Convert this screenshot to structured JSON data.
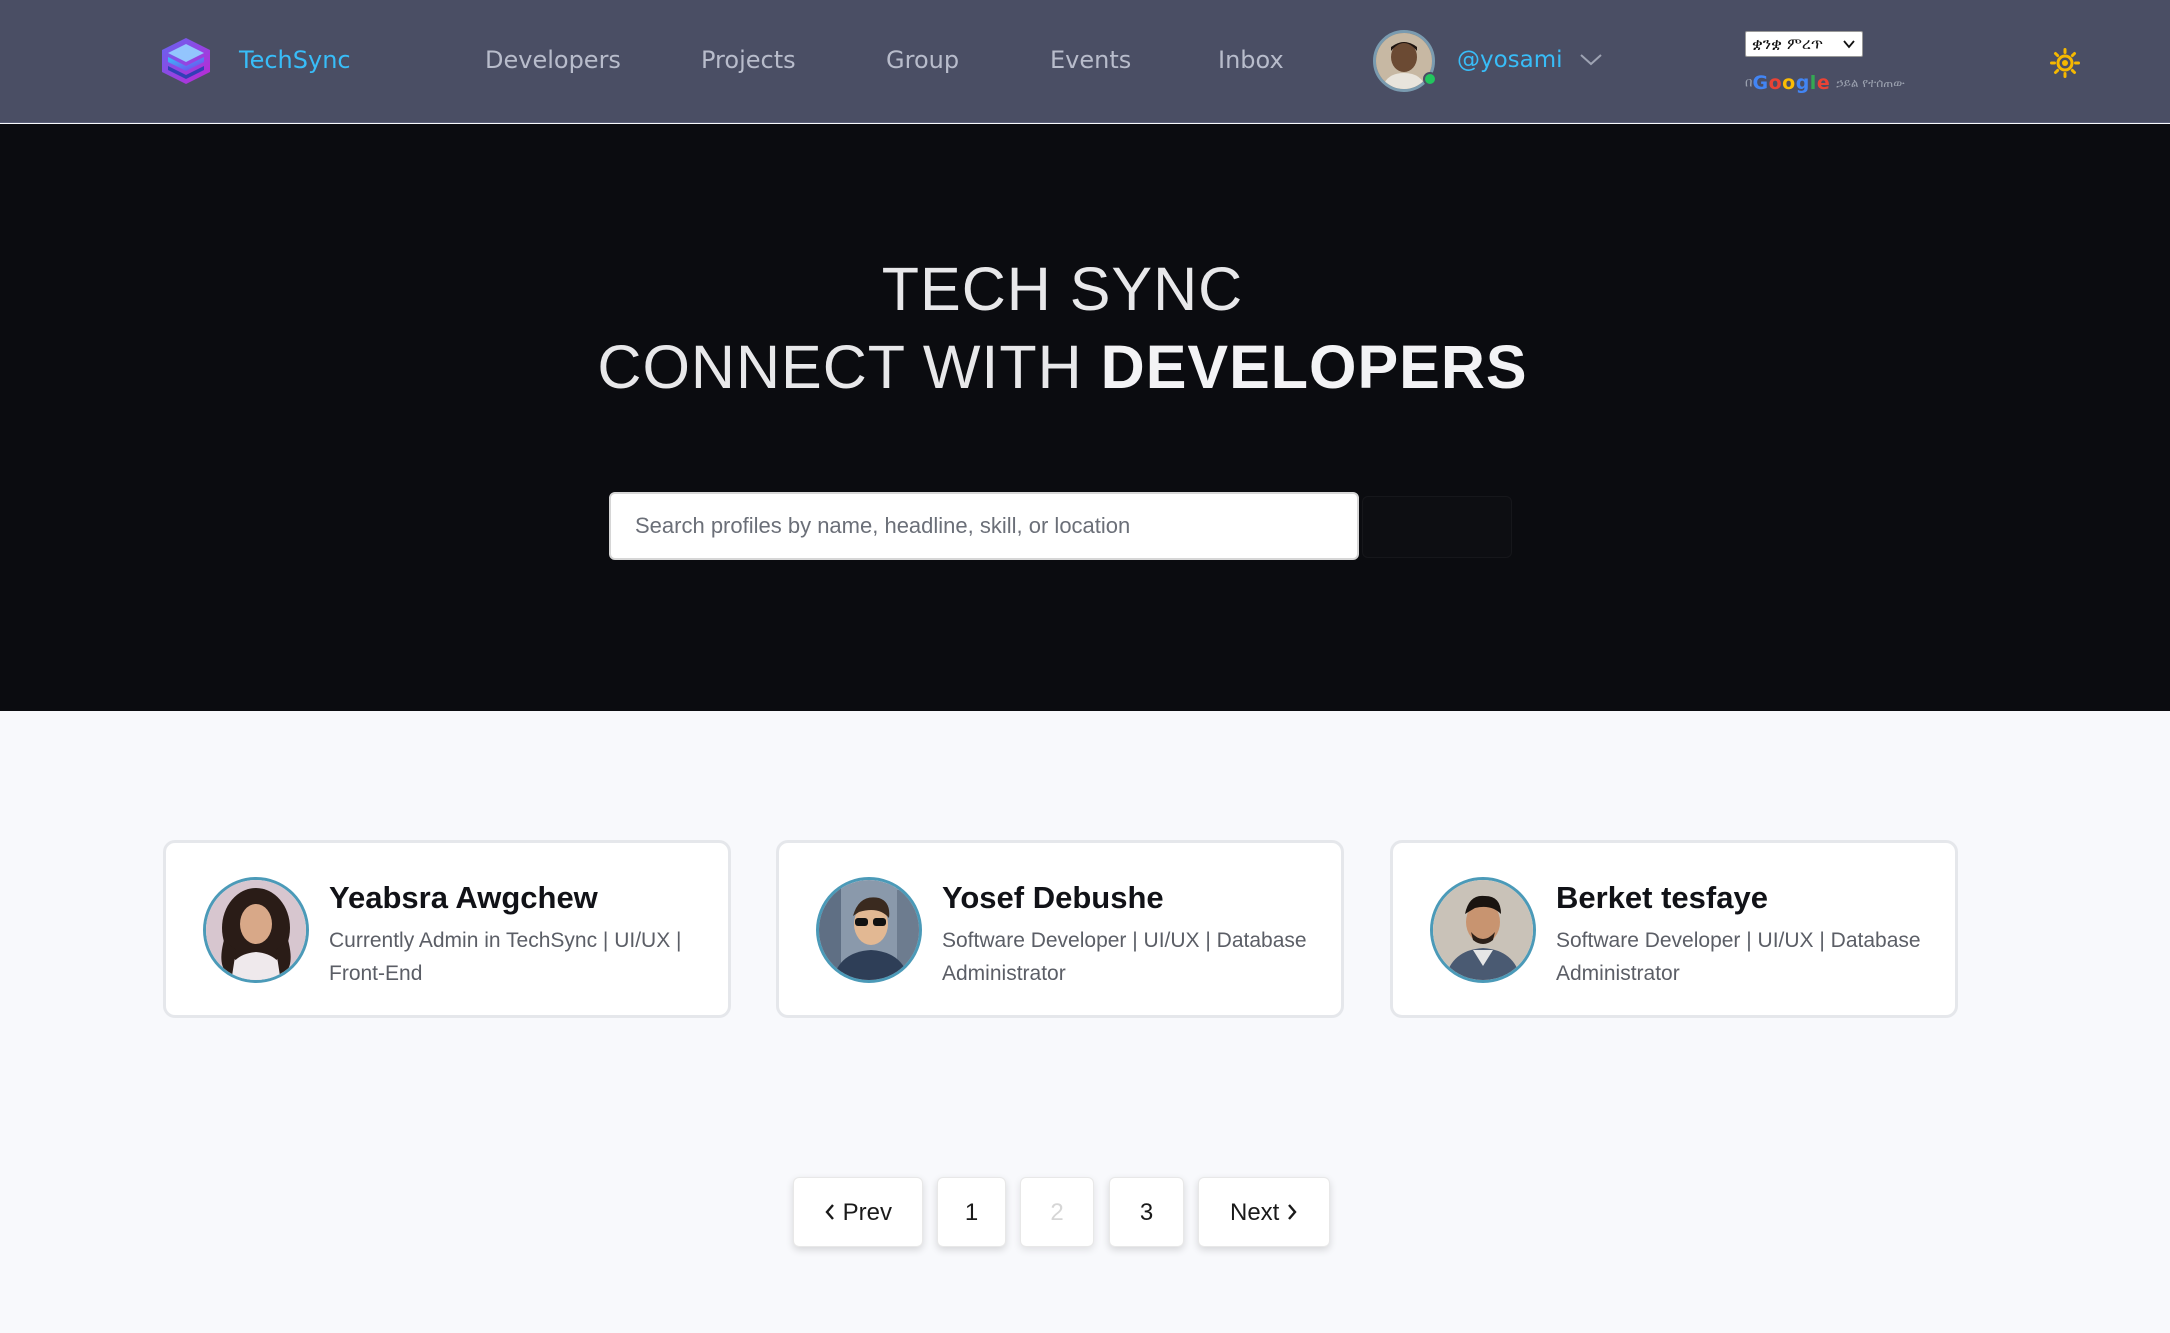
{
  "navbar": {
    "brand": "TechSync",
    "links": [
      "Developers",
      "Projects",
      "Group",
      "Events",
      "Inbox"
    ],
    "username": "@yosami",
    "language_selected": "ቋንቋ ምረጥ",
    "translate_credit_prefix": "በ",
    "translate_credit_logo": "Google",
    "translate_credit_suffix": "ኃይል የተሰጠው",
    "colors": {
      "background": "#4a4e64",
      "accent": "#38bdf8",
      "theme_icon": "#f5b800"
    },
    "icons": [
      "logo-icon",
      "chevron-down-icon",
      "sun-icon"
    ]
  },
  "hero": {
    "line1": "TECH SYNC",
    "line2_normal": "CONNECT WITH ",
    "line2_bold": "DEVELOPERS",
    "search_placeholder": "Search profiles by name, headline, skill, or location",
    "search_value": ""
  },
  "developers": [
    {
      "name": "Yeabsra Awgchew",
      "headline": "Currently Admin in TechSync | UI/UX | Front-End"
    },
    {
      "name": "Yosef Debushe",
      "headline": "Software Developer | UI/UX | Database Administrator"
    },
    {
      "name": "Berket tesfaye",
      "headline": "Software Developer | UI/UX | Database Administrator"
    }
  ],
  "pagination": {
    "prev_label": "Prev",
    "next_label": "Next",
    "pages": [
      "1",
      "2",
      "3"
    ],
    "current_page": "2"
  }
}
